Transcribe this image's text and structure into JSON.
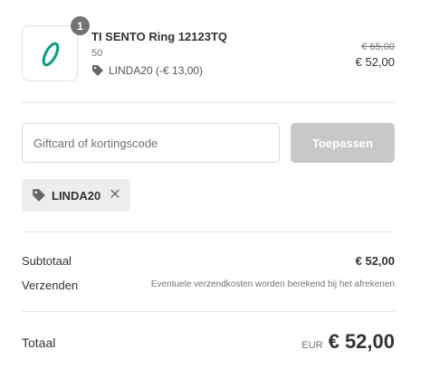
{
  "product": {
    "quantity": "1",
    "name": "TI SENTO Ring 12123TQ",
    "variant": "50",
    "discount_label": "LINDA20 (-€ 13,00)",
    "original_price": "€ 65,00",
    "price": "€ 52,00",
    "image_icon": "ring-icon"
  },
  "discount_form": {
    "placeholder": "Giftcard of kortingscode",
    "apply_label": "Toepassen",
    "applied_code": "LINDA20",
    "remove_icon": "close-icon"
  },
  "summary": {
    "subtotal_label": "Subtotaal",
    "subtotal_value": "€ 52,00",
    "shipping_label": "Verzenden",
    "shipping_note": "Eventuele verzendkosten worden berekend bij het afrekenen",
    "total_label": "Totaal",
    "total_currency": "EUR",
    "total_value": "€ 52,00"
  },
  "colors": {
    "ring": "#1aa58a",
    "button_disabled": "#c8c8c8",
    "chip_bg": "#ededed",
    "badge": "#737373"
  }
}
